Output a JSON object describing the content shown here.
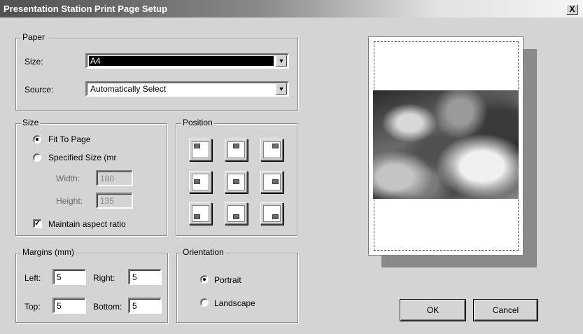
{
  "window": {
    "title": "Presentation Station Print Page Setup",
    "close_symbol": "X"
  },
  "paper": {
    "legend": "Paper",
    "size_label": "Size:",
    "size_value": "A4",
    "source_label": "Source:",
    "source_value": "Automatically Select"
  },
  "size": {
    "legend": "Size",
    "fit_label": "Fit To Page",
    "specified_label": "Specified Size (mr",
    "width_label": "Width:",
    "width_value": "180",
    "height_label": "Height:",
    "height_value": "135",
    "aspect_label": "Maintain aspect ratio",
    "aspect_checked": true,
    "selected": "fit"
  },
  "position": {
    "legend": "Position"
  },
  "margins": {
    "legend": "Margins (mm)",
    "left_label": "Left:",
    "left_value": "5",
    "right_label": "Right:",
    "right_value": "5",
    "top_label": "Top:",
    "top_value": "5",
    "bottom_label": "Bottom:",
    "bottom_value": "5"
  },
  "orientation": {
    "legend": "Orientation",
    "portrait_label": "Portrait",
    "landscape_label": "Landscape",
    "selected": "portrait"
  },
  "buttons": {
    "ok_label": "OK",
    "cancel_label": "Cancel"
  },
  "icons": {
    "dropdown": "chevron-down-icon",
    "position": "image-placement-icon",
    "check": "checkmark-icon"
  }
}
